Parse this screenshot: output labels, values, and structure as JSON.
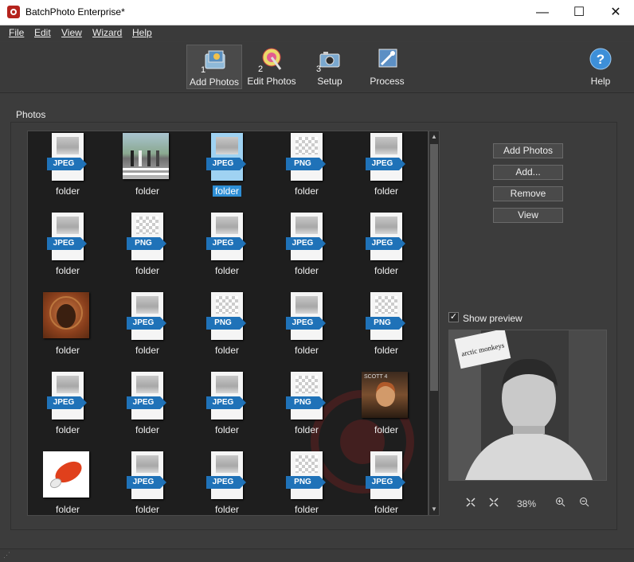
{
  "window": {
    "title": "BatchPhoto Enterprise*",
    "minimize": "—",
    "maximize": "☐",
    "close": "✕"
  },
  "menu": [
    "File",
    "Edit",
    "View",
    "Wizard",
    "Help"
  ],
  "toolbar": {
    "buttons": [
      {
        "label": "Add Photos",
        "number": "1",
        "icon": "add-photos-icon",
        "active": true
      },
      {
        "label": "Edit Photos",
        "number": "2",
        "icon": "edit-photos-icon",
        "active": false
      },
      {
        "label": "Setup",
        "number": "3",
        "icon": "setup-icon",
        "active": false
      },
      {
        "label": "Process",
        "number": "",
        "icon": "process-icon",
        "active": false
      }
    ],
    "help_label": "Help",
    "help_symbol": "?"
  },
  "photos": {
    "group_label": "Photos",
    "items": [
      {
        "type": "JPEG",
        "caption": "folder",
        "selected": false
      },
      {
        "type": "photo-abbey-road",
        "caption": "folder",
        "selected": false
      },
      {
        "type": "JPEG",
        "caption": "folder",
        "selected": true
      },
      {
        "type": "PNG",
        "caption": "folder",
        "selected": false
      },
      {
        "type": "JPEG",
        "caption": "folder",
        "selected": false
      },
      {
        "type": "JPEG",
        "caption": "folder",
        "selected": false
      },
      {
        "type": "PNG",
        "caption": "folder",
        "selected": false
      },
      {
        "type": "JPEG",
        "caption": "folder",
        "selected": false
      },
      {
        "type": "JPEG",
        "caption": "folder",
        "selected": false
      },
      {
        "type": "JPEG",
        "caption": "folder",
        "selected": false
      },
      {
        "type": "photo-album-orange",
        "caption": "folder",
        "selected": false
      },
      {
        "type": "JPEG",
        "caption": "folder",
        "selected": false
      },
      {
        "type": "PNG",
        "caption": "folder",
        "selected": false
      },
      {
        "type": "JPEG",
        "caption": "folder",
        "selected": false
      },
      {
        "type": "PNG",
        "caption": "folder",
        "selected": false
      },
      {
        "type": "JPEG",
        "caption": "folder",
        "selected": false
      },
      {
        "type": "JPEG",
        "caption": "folder",
        "selected": false
      },
      {
        "type": "JPEG",
        "caption": "folder",
        "selected": false
      },
      {
        "type": "PNG",
        "caption": "folder",
        "selected": false
      },
      {
        "type": "photo-scott4",
        "caption": "folder",
        "selected": false
      },
      {
        "type": "photo-red-object",
        "caption": "folder",
        "selected": false
      },
      {
        "type": "JPEG",
        "caption": "folder",
        "selected": false
      },
      {
        "type": "JPEG",
        "caption": "folder",
        "selected": false
      },
      {
        "type": "PNG",
        "caption": "folder",
        "selected": false
      },
      {
        "type": "JPEG",
        "caption": "folder",
        "selected": false
      }
    ],
    "photo_texts": {
      "scott4": "SCOTT 4"
    }
  },
  "side_buttons": {
    "add_photos": "Add Photos",
    "add": "Add...",
    "remove": "Remove",
    "view": "View"
  },
  "preview": {
    "show_label": "Show preview",
    "checked": "✓",
    "logo_text": "arctic monkeys"
  },
  "zoom": {
    "fit_icon": "fit-window-icon",
    "actual_icon": "actual-size-icon",
    "level": "38%",
    "zoom_in_icon": "zoom-in-icon",
    "zoom_out_icon": "zoom-out-icon"
  },
  "colors": {
    "accent": "#2e8fd6",
    "jpeg_tag": "#1f72b8"
  }
}
